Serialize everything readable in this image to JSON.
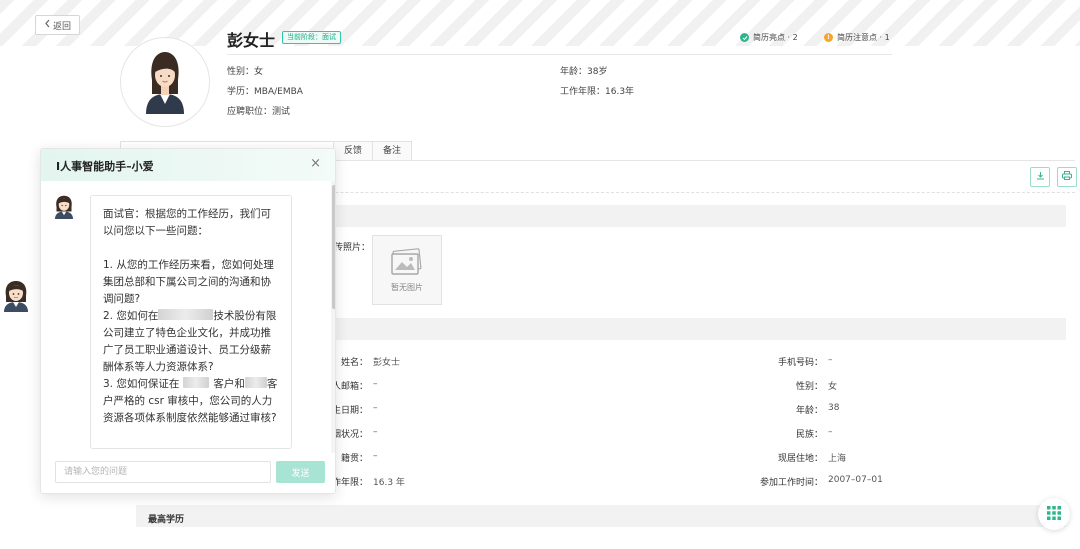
{
  "header": {
    "back_label": "返回",
    "name": "彭女士",
    "stage_tag": "当前阶段：面试",
    "highlights_label": "简历亮点 · 2",
    "warnings_label": "简历注意点 · 1"
  },
  "basic": {
    "gender": "性别：女",
    "age": "年龄：38岁",
    "education": "学历：MBA/EMBA",
    "work_years": "工作年限：16.3年",
    "position": "应聘职位：测试"
  },
  "tabs": [
    {
      "label": "反馈"
    },
    {
      "label": "备注"
    }
  ],
  "photo": {
    "label": "传照片：",
    "empty_text": "暂无图片"
  },
  "fields_left": [
    {
      "label": "姓名：",
      "value": "彭女士"
    },
    {
      "label": "人邮箱：",
      "value": "–"
    },
    {
      "label": "生日期：",
      "value": "–"
    },
    {
      "label": "姻状况：",
      "value": "–"
    },
    {
      "label": "籍贯：",
      "value": "–"
    },
    {
      "label": "作年限：",
      "value": "16.3 年"
    }
  ],
  "fields_right": [
    {
      "label": "手机号码：",
      "value": "–"
    },
    {
      "label": "性别：",
      "value": "女"
    },
    {
      "label": "年龄：",
      "value": "38"
    },
    {
      "label": "民族：",
      "value": "–"
    },
    {
      "label": "现居住地：",
      "value": "上海"
    },
    {
      "label": "参加工作时间：",
      "value": "2007–07–01"
    }
  ],
  "sections": {
    "education": "最高学历"
  },
  "chat": {
    "title": "I人事智能助手–小爱",
    "close": "×",
    "message": {
      "intro": "面试官：根据您的工作经历，我们可以问您以下一些问题：",
      "q1": "1. 从您的工作经历来看，您如何处理集团总部和下属公司之间的沟通和协调问题?",
      "q2_a": "2. 您如何在",
      "q2_b": "技术股份有限公司建立了特色企业文化，并成功推广了员工职业通道设计、员工分级薪酬体系等人力资源体系?",
      "q3_a": "3. 您如何保证在",
      "q3_b": "客户和",
      "q3_c": "客户严格的 csr 审核中，您公司的人力资源各项体系制度依然能够通过审核?"
    },
    "input_placeholder": "请输入您的问题",
    "send_label": "发送"
  },
  "colors": {
    "accent": "#33c6a6",
    "highlight_dot": "#2fb58e",
    "warning_dot": "#f5a623",
    "send_disabled": "#a7e4d4"
  },
  "icons": {
    "back": "chevron-left-icon",
    "download": "download-icon",
    "print": "print-icon",
    "photo_placeholder": "image-placeholder-icon",
    "apps": "grid-icon"
  }
}
